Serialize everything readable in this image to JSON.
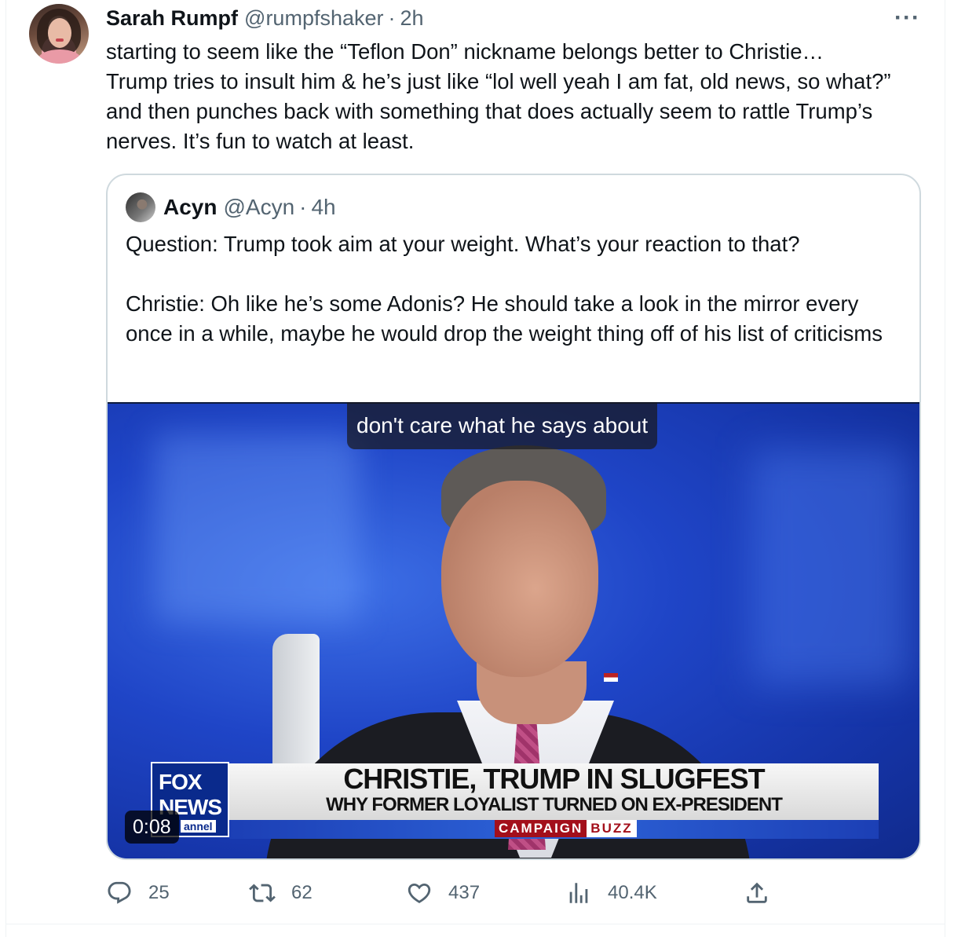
{
  "tweet": {
    "author_name": "Sarah Rumpf",
    "author_handle": "@rumpfshaker",
    "separator": "·",
    "time": "2h",
    "more_label": "···",
    "text": "starting to seem like the “Teflon Don” nickname belongs better to Christie…\nTrump tries to insult him & he’s just like “lol well yeah I am fat, old news, so what?” and then punches back with something that does actually seem to rattle Trump’s nerves. It’s fun to watch at least."
  },
  "quote": {
    "author_name": "Acyn",
    "author_handle": "@Acyn",
    "separator": "·",
    "time": "4h",
    "text": "Question: Trump took aim at your weight. What’s your reaction to that?\n\nChristie: Oh like he’s some Adonis? He should take a look in the mirror every once in a while, maybe he would drop the weight thing off of his list of criticisms",
    "video": {
      "caption": "don't care what he says about",
      "duration": "0:08",
      "logo_top": "FOX",
      "logo_bottom": "NEWS",
      "logo_sub": "annel",
      "headline": "CHRISTIE, TRUMP IN SLUGFEST",
      "subheadline": "WHY FORMER LOYALIST TURNED ON EX-PRESIDENT",
      "tag_a": "CAMPAIGN",
      "tag_b": "BUZZ"
    }
  },
  "actions": {
    "replies": "25",
    "reposts": "62",
    "likes": "437",
    "views": "40.4K",
    "icons": [
      "reply-icon",
      "repost-icon",
      "like-icon",
      "views-icon",
      "share-icon"
    ]
  },
  "colors": {
    "text": "#0f1419",
    "muted": "#536471",
    "border": "#cfd9de",
    "fox_blue": "#0a2a8c",
    "campaign_red": "#a30f1b"
  }
}
